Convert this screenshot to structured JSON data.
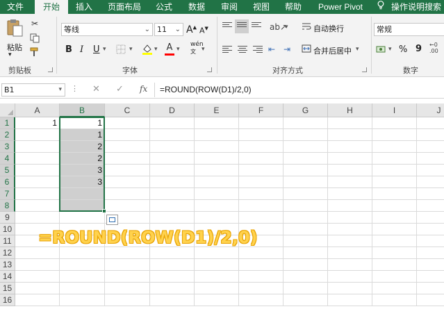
{
  "tabs": [
    {
      "label": "文件"
    },
    {
      "label": "开始"
    },
    {
      "label": "插入"
    },
    {
      "label": "页面布局"
    },
    {
      "label": "公式"
    },
    {
      "label": "数据"
    },
    {
      "label": "审阅"
    },
    {
      "label": "视图"
    },
    {
      "label": "帮助"
    },
    {
      "label": "Power Pivot"
    },
    {
      "label": "操作说明搜索"
    }
  ],
  "active_tab": "开始",
  "ribbon": {
    "clipboard": {
      "paste_label": "粘贴",
      "group_label": "剪贴板"
    },
    "font": {
      "font_name": "等线",
      "font_size": "11",
      "grow_label": "A",
      "shrink_label": "A",
      "bold": "B",
      "italic": "I",
      "underline": "U",
      "font_color_letter": "A",
      "phonetic_label": "wén",
      "group_label": "字体",
      "fill_color": "#ffff00",
      "font_color": "#ff0000"
    },
    "alignment": {
      "wrap_label": "自动换行",
      "merge_label": "合并后居中",
      "group_label": "对齐方式"
    },
    "number": {
      "format_value": "常规",
      "percent": "%",
      "comma": "9",
      "group_label": "数字"
    }
  },
  "formula_bar": {
    "name_box": "B1",
    "cancel": "✕",
    "enter": "✓",
    "fx": "fx",
    "formula": "=ROUND(ROW(D1)/2,0)"
  },
  "grid": {
    "columns": [
      "A",
      "B",
      "C",
      "D",
      "E",
      "F",
      "G",
      "H",
      "I",
      "J"
    ],
    "rows": [
      "1",
      "2",
      "3",
      "4",
      "5",
      "6",
      "7",
      "8",
      "9",
      "10",
      "11",
      "12",
      "13",
      "14",
      "15",
      "16"
    ],
    "selected_column": "B",
    "cells": [
      {
        "ref": "A1",
        "value": "1"
      },
      {
        "ref": "B1",
        "value": "1"
      },
      {
        "ref": "B2",
        "value": "1"
      },
      {
        "ref": "B3",
        "value": "2"
      },
      {
        "ref": "B4",
        "value": "2"
      },
      {
        "ref": "B5",
        "value": "3"
      },
      {
        "ref": "B6",
        "value": "3"
      }
    ]
  },
  "overlay_formula": "=ROUND(ROW(D1)/2,0)",
  "colors": {
    "accent": "#217346",
    "overlay_text": "#ffd24d",
    "selection_fill": "#cfcfcf"
  }
}
